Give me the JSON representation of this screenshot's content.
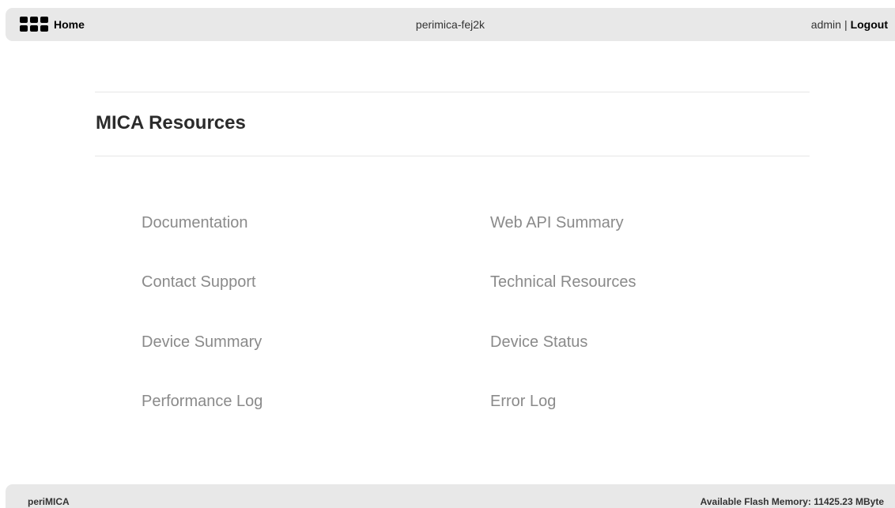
{
  "header": {
    "home_label": "Home",
    "home_icon": "grid-apps-icon",
    "hostname": "perimica-fej2k",
    "user": "admin",
    "separator": "|",
    "logout_label": "Logout"
  },
  "main": {
    "title": "MICA Resources",
    "links_left": [
      "Documentation",
      "Contact Support",
      "Device Summary",
      "Performance Log"
    ],
    "links_right": [
      "Web API Summary",
      "Technical Resources",
      "Device Status",
      "Error Log"
    ]
  },
  "footer": {
    "brand": "periMICA",
    "memory_text": "Available Flash Memory: 11425.23 MByte"
  }
}
